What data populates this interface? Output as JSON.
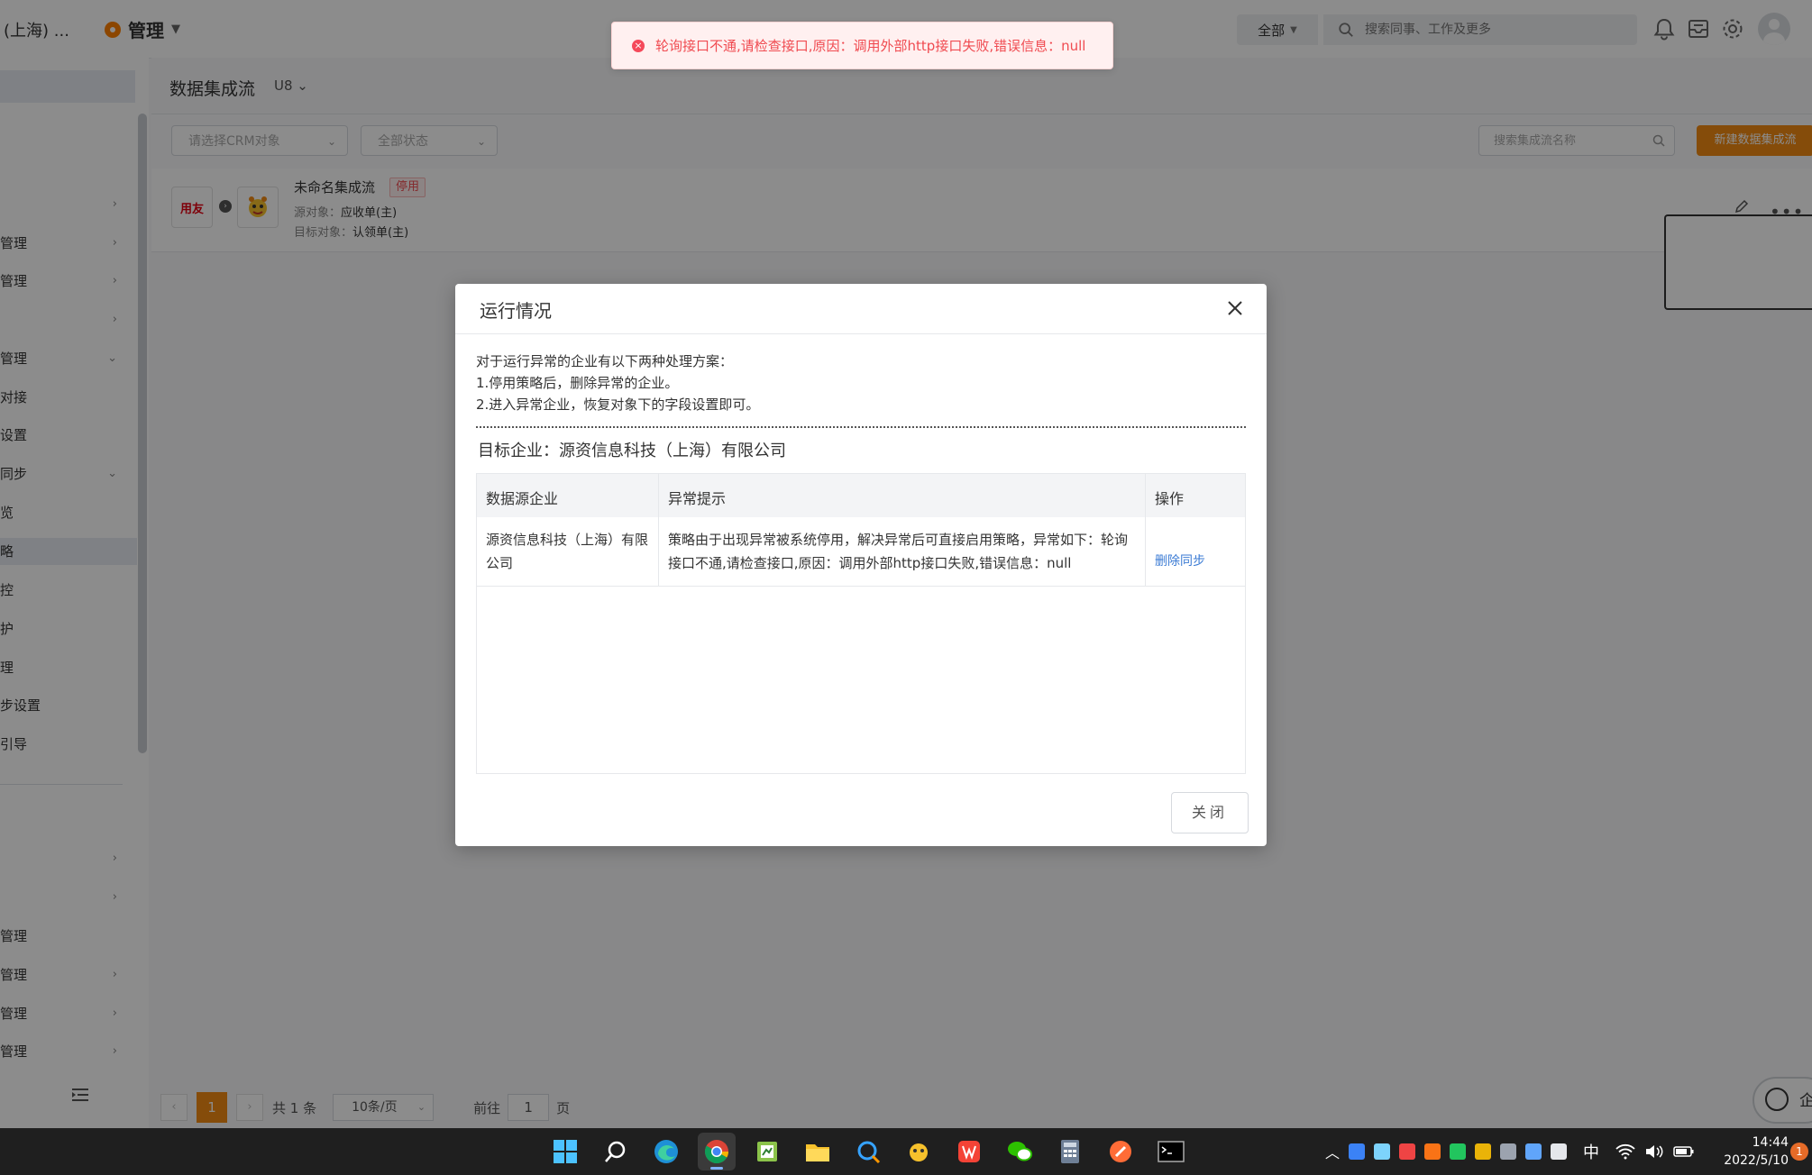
{
  "header": {
    "company": "(上海) ...",
    "admin_label": "管理",
    "scope": "全部",
    "search_placeholder": "搜索同事、工作及更多"
  },
  "toast": {
    "message": "轮询接口不通,请检查接口,原因：调用外部http接口失败,错误信息：null"
  },
  "sidebar": {
    "items": [
      {
        "label": "",
        "chevron": "›"
      },
      {
        "label": "管理",
        "chevron": "›"
      },
      {
        "label": "管理",
        "chevron": "›"
      },
      {
        "label": "",
        "chevron": "›"
      },
      {
        "label": "管理",
        "chevron": "⌄"
      },
      {
        "label": "对接",
        "chevron": ""
      },
      {
        "label": "设置",
        "chevron": ""
      },
      {
        "label": "同步",
        "chevron": "⌄"
      },
      {
        "label": "览",
        "chevron": ""
      },
      {
        "label": "略",
        "chevron": ""
      },
      {
        "label": "控",
        "chevron": ""
      },
      {
        "label": "护",
        "chevron": ""
      },
      {
        "label": "理",
        "chevron": ""
      },
      {
        "label": "步设置",
        "chevron": ""
      },
      {
        "label": "引导",
        "chevron": ""
      }
    ],
    "lower_items": [
      {
        "label": "",
        "chevron": "›"
      },
      {
        "label": "",
        "chevron": "›"
      },
      {
        "label": "管理",
        "chevron": ""
      },
      {
        "label": "管理",
        "chevron": "›"
      },
      {
        "label": "管理",
        "chevron": "›"
      },
      {
        "label": "管理",
        "chevron": "›"
      }
    ]
  },
  "page": {
    "title": "数据集成流",
    "subtitle": "U8 ⌄",
    "filter_crm": "请选择CRM对象",
    "filter_status": "全部状态",
    "search_placeholder": "搜索集成流名称",
    "new_button": "新建数据集成流"
  },
  "flow": {
    "logo_text": "用友",
    "name": "未命名集成流",
    "badge": "停用",
    "src_label": "源对象：",
    "src_value": "应收单(主)",
    "dst_label": "目标对象：",
    "dst_value": "认领单(主)"
  },
  "pager": {
    "prev": "‹",
    "page": "1",
    "next": "›",
    "total": "共 1 条",
    "size": "10条/页",
    "goto": "前往",
    "goto_value": "1",
    "page_unit": "页"
  },
  "float_button": {
    "label": "企"
  },
  "modal": {
    "title": "运行情况",
    "tips": [
      "对于运行异常的企业有以下两种处理方案：",
      "1.停用策略后，删除异常的企业。",
      "2.进入异常企业，恢复对象下的字段设置即可。"
    ],
    "target": "目标企业：源资信息科技（上海）有限公司",
    "columns": [
      "数据源企业",
      "异常提示",
      "操作"
    ],
    "rows": [
      {
        "source": "源资信息科技（上海）有限公司",
        "hint": "策略由于出现异常被系统停用，解决异常后可直接启用策略，异常如下：轮询接口不通,请检查接口,原因：调用外部http接口失败,错误信息：null",
        "action": "删除同步"
      }
    ],
    "close_button": "关闭"
  },
  "taskbar": {
    "ime": "中",
    "time": "14:44",
    "date": "2022/5/10",
    "notifications": "1"
  },
  "colors": {
    "accent": "#f28a13",
    "error": "#f04b51",
    "link": "#3b7bd4"
  }
}
